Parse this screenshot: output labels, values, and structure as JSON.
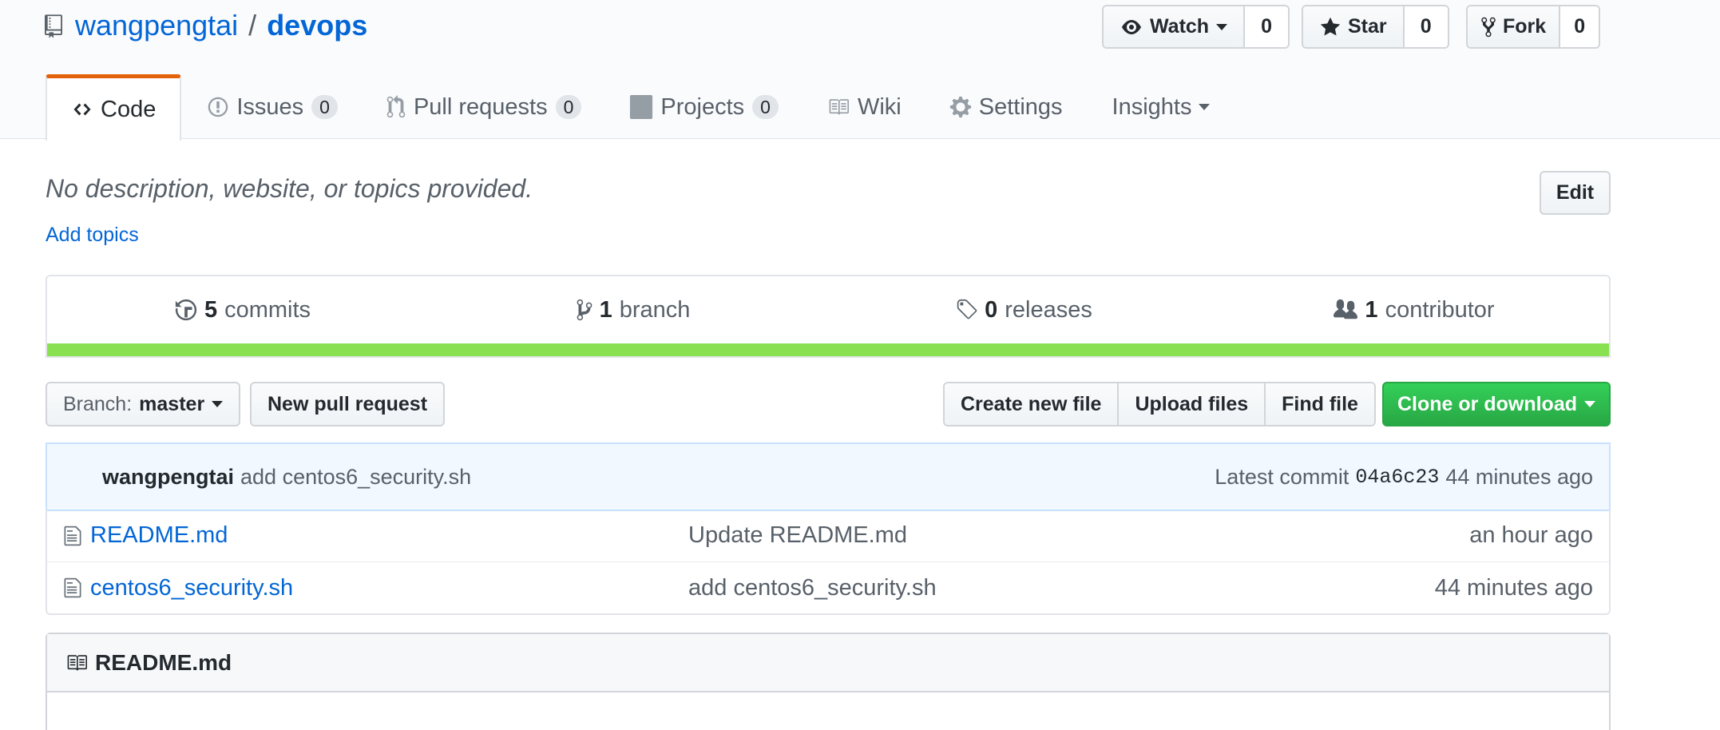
{
  "repo": {
    "owner": "wangpengtai",
    "separator": "/",
    "name": "devops"
  },
  "actions": {
    "watch": {
      "label": "Watch",
      "count": "0"
    },
    "star": {
      "label": "Star",
      "count": "0"
    },
    "fork": {
      "label": "Fork",
      "count": "0"
    }
  },
  "tabs": [
    {
      "label": "Code",
      "icon": "code-icon",
      "selected": true
    },
    {
      "label": "Issues",
      "counter": "0",
      "icon": "issue-opened-icon"
    },
    {
      "label": "Pull requests",
      "counter": "0",
      "icon": "git-pull-request-icon"
    },
    {
      "label": "Projects",
      "counter": "0",
      "icon": "project-icon"
    },
    {
      "label": "Wiki",
      "icon": "book-icon"
    },
    {
      "label": "Settings",
      "icon": "gear-icon"
    },
    {
      "label": "Insights",
      "icon": "caret-down-icon"
    }
  ],
  "description": {
    "text": "No description, website, or topics provided.",
    "add_topics": "Add topics",
    "edit": "Edit"
  },
  "summary": {
    "commits": {
      "num": "5",
      "label": "commits"
    },
    "branches": {
      "num": "1",
      "label": "branch"
    },
    "releases": {
      "num": "0",
      "label": "releases"
    },
    "contributors": {
      "num": "1",
      "label": "contributor"
    },
    "language_color": "#89e051"
  },
  "file_nav": {
    "branch_prefix": "Branch:",
    "branch_name": "master",
    "new_pull_request": "New pull request",
    "create_new_file": "Create new file",
    "upload_files": "Upload files",
    "find_file": "Find file",
    "clone_or_download": "Clone or download"
  },
  "latest_commit": {
    "author": "wangpengtai",
    "message": "add centos6_security.sh",
    "prefix": "Latest commit",
    "sha": "04a6c23",
    "age": "44 minutes ago"
  },
  "files": [
    {
      "name": "README.md",
      "message": "Update README.md",
      "age": "an hour ago"
    },
    {
      "name": "centos6_security.sh",
      "message": "add centos6_security.sh",
      "age": "44 minutes ago"
    }
  ],
  "readme": {
    "title": "README.md"
  },
  "colors": {
    "link": "#0366d6",
    "tab_accent": "#e36209",
    "clone_green": "#28a745",
    "commit_bg": "#f1f8ff"
  }
}
